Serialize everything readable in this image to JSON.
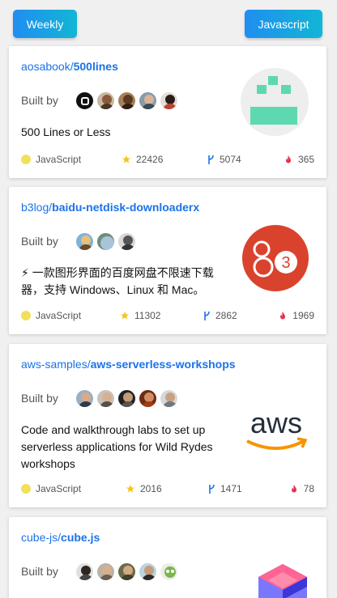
{
  "header": {
    "period_label": "Weekly",
    "language_label": "Javascript"
  },
  "built_by_label": "Built by",
  "colors": {
    "accent": "#1a73e8",
    "button_gradient_start": "#1f8ef0",
    "button_gradient_end": "#12b6d6",
    "javascript_dot": "#f1e05a",
    "star": "#f5c518",
    "fork": "#1a73e8",
    "hot": "#e8304a"
  },
  "repos": [
    {
      "owner": "aosabook/",
      "name": "500lines",
      "description": "500 Lines or Less",
      "language": "JavaScript",
      "stars": "22426",
      "forks": "5074",
      "hot": "365",
      "logo": "green-pixel-face-logo",
      "avatars": [
        "avatar-black-logo",
        "avatar-curly-hair",
        "avatar-dark-hair",
        "avatar-man",
        "avatar-woman"
      ]
    },
    {
      "owner": "b3log/",
      "name": "baidu-netdisk-downloaderx",
      "description": "⚡ 一款图形界面的百度网盘不限速下载器，支持 Windows、Linux 和 Mac。",
      "language": "JavaScript",
      "stars": "11302",
      "forks": "2862",
      "hot": "1969",
      "logo": "b3-red-circle-logo",
      "avatars": [
        "avatar-cartoon",
        "avatar-globe",
        "avatar-grayscale"
      ]
    },
    {
      "owner": "aws-samples/",
      "name": "aws-serverless-workshops",
      "description": "Code and walkthrough labs to set up serverless applications for Wild Rydes workshops",
      "language": "JavaScript",
      "stars": "2016",
      "forks": "1471",
      "hot": "78",
      "logo": "aws-logo",
      "logo_text": "aws",
      "avatars": [
        "avatar-man-glasses",
        "avatar-man-smile",
        "avatar-man-beard",
        "avatar-woman-red",
        "avatar-man-sunglasses"
      ]
    },
    {
      "owner": "cube-js/",
      "name": "cube.js",
      "avatars": [
        "avatar-man-dark",
        "avatar-man-light",
        "avatar-man-hat",
        "avatar-man-sky",
        "avatar-cartoon-monster"
      ],
      "logo": "cube-logo"
    }
  ]
}
